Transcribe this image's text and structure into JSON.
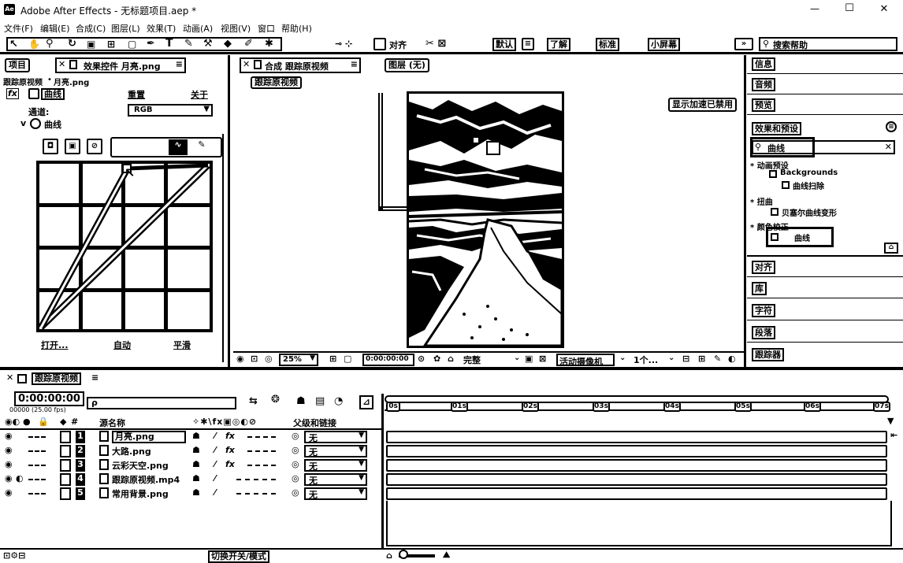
{
  "window": {
    "title": "Adobe After Effects - 无标题项目.aep *",
    "minimize": "—",
    "maximize": "☐",
    "close": "✕"
  },
  "menu": [
    "文件(F)",
    "编辑(E)",
    "合成(C)",
    "图层(L)",
    "效果(T)",
    "动画(A)",
    "视图(V)",
    "窗口",
    "帮助(H)"
  ],
  "toolbar": {
    "align_label": "对齐",
    "workspaces": [
      "默认",
      "了解",
      "标准",
      "小屏幕"
    ],
    "search_help": "搜索帮助"
  },
  "left_panel": {
    "tab_project": "项目",
    "tab_effect_controls": "效果控件 月亮.png",
    "breadcrumb_comp": "跟踪原视频",
    "breadcrumb_layer": "月亮.png",
    "effect_fx": "fx",
    "effect_name": "曲线",
    "reset_label": "重置",
    "about_label": "关于",
    "channel_label": "通道:",
    "channel_value": "RGB",
    "curve_label": "曲线",
    "btn_open": "打开...",
    "btn_auto": "自动",
    "btn_smooth": "平滑"
  },
  "comp_panel": {
    "tab_label": "合成 跟踪原视频",
    "layer_tab": "图层 (无)",
    "sub_tab": "跟踪原视频",
    "accel_notice": "显示加速已禁用",
    "zoom": "25%",
    "timecode": "0:00:00:00",
    "resolution": "完整",
    "camera": "活动摄像机",
    "views": "1个..."
  },
  "right_panel": {
    "items_top": [
      "信息",
      "音频",
      "预览"
    ],
    "effects_title": "效果和预设",
    "search_value": "曲线",
    "tree": [
      "* 动画预设",
      "Backgrounds",
      "曲线扫除",
      "* 扭曲",
      "贝塞尔曲线变形",
      "* 颜色校正",
      "曲线"
    ],
    "items_bottom": [
      "对齐",
      "库",
      "字符",
      "段落",
      "跟踪器"
    ]
  },
  "timeline": {
    "tab_label": "跟踪原视频",
    "timecode": "0:00:00:00",
    "frame_info": "00000 (25.00 fps)",
    "search_placeholder": "ρ",
    "col_source": "源名称",
    "col_parent": "父级和链接",
    "toggle_label": "切换开关/模式",
    "ruler": [
      "0s",
      "01s",
      "02s",
      "03s",
      "04s",
      "05s",
      "06s",
      "07s"
    ],
    "layers": [
      {
        "num": "1",
        "name": "月亮.png",
        "parent": "无"
      },
      {
        "num": "2",
        "name": "大路.png",
        "parent": "无"
      },
      {
        "num": "3",
        "name": "云彩天空.png",
        "parent": "无"
      },
      {
        "num": "4",
        "name": "跟踪原视频.mp4",
        "parent": "无"
      },
      {
        "num": "5",
        "name": "常用背景.png",
        "parent": "无"
      }
    ]
  }
}
